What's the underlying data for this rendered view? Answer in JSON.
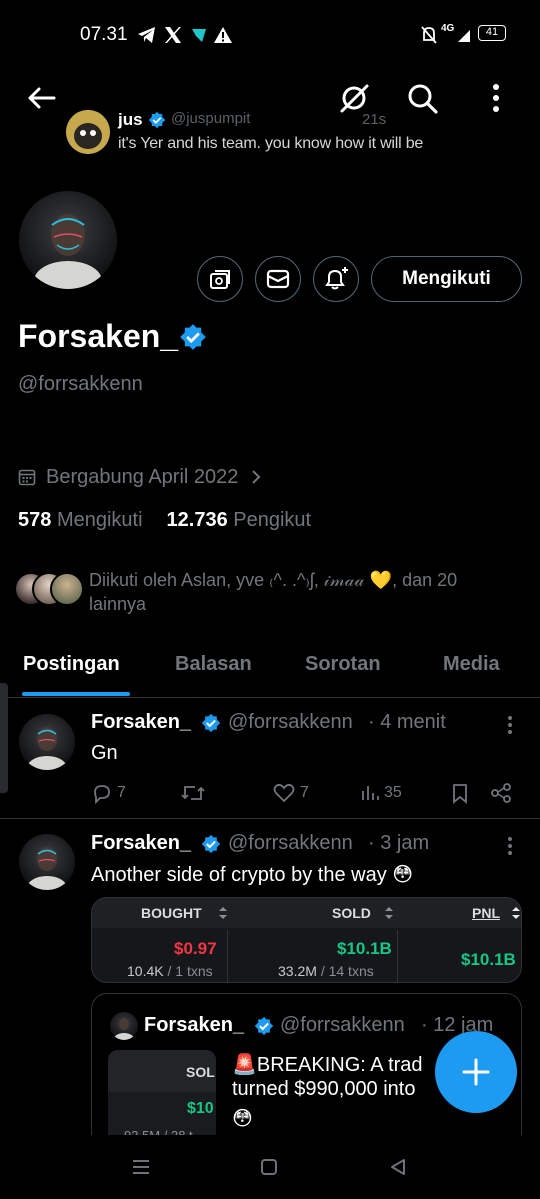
{
  "status_bar": {
    "time": "07.31",
    "battery": "41",
    "network": "4G"
  },
  "preview_tweet": {
    "name": "jus",
    "handle": "@juspumpit",
    "time": "21s",
    "text": "it's Yer and his team. you know how it will be"
  },
  "profile": {
    "display_name": "Forsaken_",
    "handle": "@forrsakkenn",
    "follow_label": "Mengikuti",
    "joined": "Bergabung April 2022",
    "following_count": "578",
    "following_label": "Mengikuti",
    "followers_count": "12.736",
    "followers_label": "Pengikut",
    "followed_by": "Diikuti oleh Aslan, yve ₍^. .^₎ʃ, 𝒾𝓂𝒶𝒶 💛, dan 20 lainnya"
  },
  "tabs": [
    {
      "label": "Postingan"
    },
    {
      "label": "Balasan"
    },
    {
      "label": "Sorotan"
    },
    {
      "label": "Media"
    }
  ],
  "posts": [
    {
      "name": "Forsaken_",
      "handle": "@forrsakkenn",
      "time": "· 4 menit",
      "text": "Gn",
      "replies": "7",
      "retweets": "",
      "likes": "7",
      "views": "35"
    },
    {
      "name": "Forsaken_",
      "handle": "@forrsakkenn",
      "time": "· 3 jam",
      "text": "Another side of crypto by the way 😳"
    }
  ],
  "trade_card": {
    "headers": [
      "BOUGHT",
      "SOLD",
      "PNL"
    ],
    "bought_value": "$0.97",
    "bought_amount": "10.4K",
    "bought_txns": "/ 1 txns",
    "sold_value": "$10.1B",
    "sold_amount": "33.2M",
    "sold_txns": "/ 14 txns",
    "pnl_value": "$10.1B"
  },
  "quote": {
    "name": "Forsaken_",
    "handle": "@forrsakkenn",
    "time": "· 12 jam",
    "text_line1": "🚨BREAKING: A trad",
    "text_line2": "turned $990,000 into",
    "text_line3": "😳",
    "thumb_header": "SOL",
    "thumb_value": "$10",
    "thumb_sub": "93.5M / 38 t"
  },
  "colors": {
    "accent": "#1d9bf0",
    "background": "#000000",
    "muted": "#71767b",
    "red": "#f23645",
    "green": "#16c784"
  }
}
